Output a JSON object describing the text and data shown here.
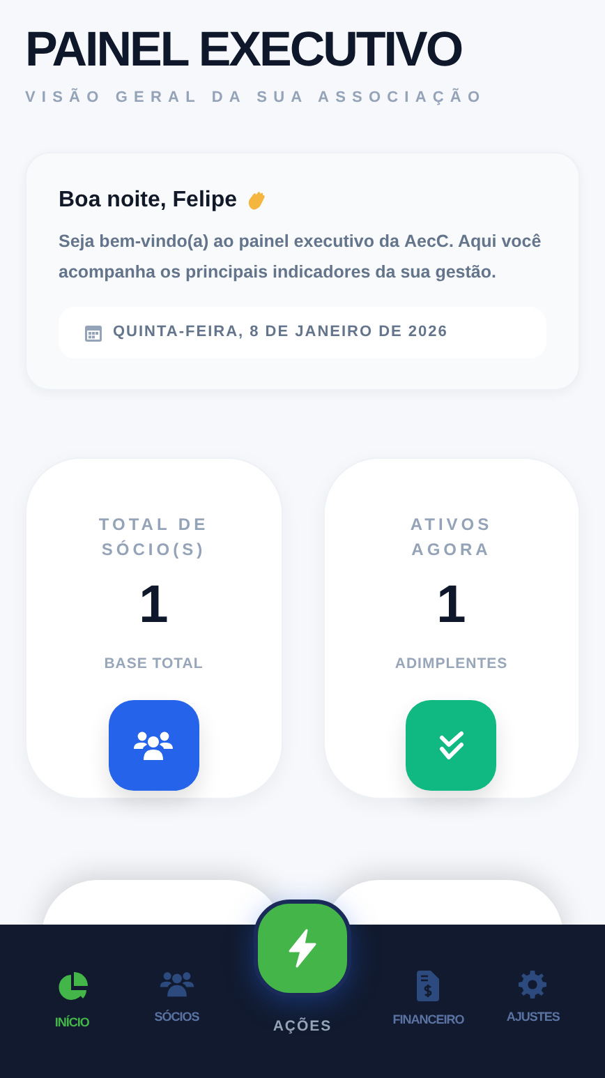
{
  "header": {
    "title": "PAINEL EXECUTIVO",
    "subtitle": "VISÃO GERAL DA SUA ASSOCIAÇÃO"
  },
  "welcome": {
    "greeting": "Boa noite, Felipe",
    "message": "Seja bem-vindo(a) ao painel executivo da **AecC**. Aqui você acompanha os principais indicadores da sua gestão.",
    "date": "QUINTA-FEIRA, 8 DE JANEIRO DE 2026"
  },
  "stats": [
    {
      "label": "TOTAL DE SÓCIO(S)",
      "value": "1",
      "caption": "BASE TOTAL",
      "kind": "members",
      "color": "#2563eb"
    },
    {
      "label": "ATIVOS AGORA",
      "value": "1",
      "caption": "ADIMPLENTES",
      "kind": "active",
      "color": "#10b981"
    }
  ],
  "nav": [
    {
      "label": "INÍCIO",
      "kind": "home",
      "selected": true
    },
    {
      "label": "SÓCIOS",
      "kind": "members",
      "selected": false
    },
    {
      "label": "AÇÕES",
      "kind": "action",
      "selected": false
    },
    {
      "label": "FINANCEIRO",
      "kind": "finance",
      "selected": false
    },
    {
      "label": "AJUSTES",
      "kind": "settings",
      "selected": false
    }
  ]
}
